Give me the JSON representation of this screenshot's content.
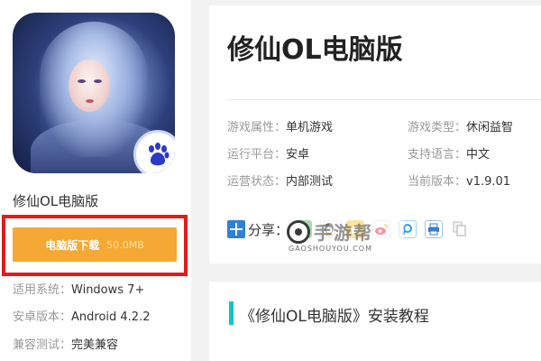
{
  "left": {
    "app_name": "修仙OL电脑版",
    "download": {
      "label": "电脑版下载",
      "size": "50.0MB"
    },
    "specs": [
      {
        "key": "适用系统：",
        "value": "Windows 7+"
      },
      {
        "key": "安卓版本：",
        "value": "Android 4.2.2"
      },
      {
        "key": "兼容测试：",
        "value": "完美兼容"
      }
    ]
  },
  "main": {
    "title": "修仙OL电脑版",
    "info": {
      "game_attr": {
        "key": "游戏属性：",
        "value": "单机游戏"
      },
      "game_type": {
        "key": "游戏类型：",
        "value": "休闲益智"
      },
      "platform": {
        "key": "运行平台：",
        "value": "安卓"
      },
      "language": {
        "key": "支持语言：",
        "value": "中文"
      },
      "status": {
        "key": "运营状态：",
        "value": "内部测试"
      },
      "version": {
        "key": "当前版本：",
        "value": "v1.9.01"
      }
    },
    "share": {
      "label": "分享：",
      "icons": [
        "share-plus-icon",
        "wechat-icon",
        "qq-icon",
        "qzone-icon",
        "weibo-icon",
        "tencent-weibo-icon",
        "print-icon",
        "copy-icon"
      ]
    }
  },
  "watermark": {
    "cn": "手游帮",
    "en": "GAOSHOUYOU.COM"
  },
  "section": {
    "title": "《修仙OL电脑版》安装教程"
  },
  "colors": {
    "download_button": "#f5a833",
    "highlight_border": "#e21b1b",
    "accent_bar": "#13c2c2",
    "share_blue": "#2f80d8"
  }
}
